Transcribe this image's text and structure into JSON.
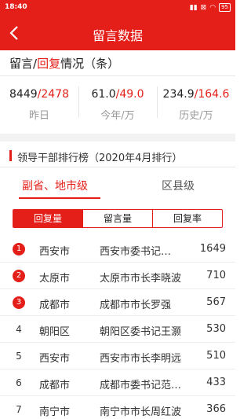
{
  "status_bar": {
    "time": "18:40",
    "icons": [
      "network-icon",
      "dnd-icon",
      "wifi-icon"
    ],
    "battery": "95"
  },
  "app_bar": {
    "title": "留言数据"
  },
  "overview": {
    "title_part1": "留言/",
    "title_red": "回复",
    "title_part2": "情况（条）",
    "stats": [
      {
        "a": "8449",
        "sep": "/",
        "b": "2478",
        "label": "昨日"
      },
      {
        "a": "61.0",
        "sep": "/",
        "b": "49.0",
        "label": "今年/万"
      },
      {
        "a": "234.9",
        "sep": "/",
        "b": "164.6",
        "label": "历史/万"
      }
    ]
  },
  "ranking": {
    "title": "领导干部排行榜（2020年4月排行）",
    "scope_tabs": [
      "副省、地市级",
      "区县级"
    ],
    "metric_tabs": [
      "回复量",
      "留言量",
      "回复率"
    ],
    "rows": [
      {
        "rank": "1",
        "city": "西安市",
        "name": "西安市委书记…",
        "value": "1649"
      },
      {
        "rank": "2",
        "city": "太原市",
        "name": "太原市市长李晓波",
        "value": "710"
      },
      {
        "rank": "3",
        "city": "成都市",
        "name": "成都市市长罗强",
        "value": "567"
      },
      {
        "rank": "4",
        "city": "朝阳区",
        "name": "朝阳区委书记王灏",
        "value": "530"
      },
      {
        "rank": "5",
        "city": "西安市",
        "name": "西安市市长李明远",
        "value": "510"
      },
      {
        "rank": "6",
        "city": "成都市",
        "name": "成都市委书记范…",
        "value": "433"
      },
      {
        "rank": "7",
        "city": "南宁市",
        "name": "南宁市市长周红波",
        "value": "366"
      }
    ]
  },
  "colors": {
    "accent": "#e41f19"
  }
}
